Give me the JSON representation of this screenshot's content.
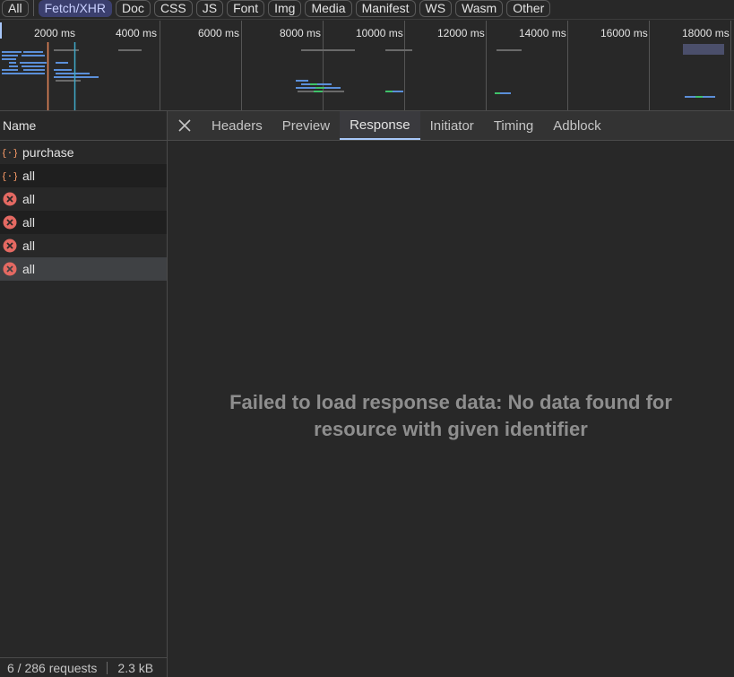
{
  "filters": [
    "All",
    "Fetch/XHR",
    "Doc",
    "CSS",
    "JS",
    "Font",
    "Img",
    "Media",
    "Manifest",
    "WS",
    "Wasm",
    "Other"
  ],
  "active_filter": "Fetch/XHR",
  "timeline": {
    "ticks": [
      "2000 ms",
      "4000 ms",
      "6000 ms",
      "8000 ms",
      "10000 ms",
      "12000 ms",
      "14000 ms",
      "16000 ms",
      "18000 ms"
    ]
  },
  "name_column": {
    "header": "Name",
    "requests": [
      {
        "name": "purchase",
        "icon": "fetch-icon",
        "status": "ok"
      },
      {
        "name": "all",
        "icon": "fetch-icon",
        "status": "ok"
      },
      {
        "name": "all",
        "icon": "error-icon",
        "status": "failed"
      },
      {
        "name": "all",
        "icon": "error-icon",
        "status": "failed"
      },
      {
        "name": "all",
        "icon": "error-icon",
        "status": "failed"
      },
      {
        "name": "all",
        "icon": "error-icon",
        "status": "failed"
      }
    ]
  },
  "status_bar": {
    "requests": "6 / 286 requests",
    "size": "2.3 kB"
  },
  "detail": {
    "tabs": [
      "Headers",
      "Preview",
      "Response",
      "Initiator",
      "Timing",
      "Adblock"
    ],
    "active_tab": "Response",
    "message": "Failed to load response data: No data found for resource with given identifier"
  },
  "colors": {
    "accent": "#a8c7fa",
    "error": "#e46962",
    "fetch": "#f29766"
  }
}
